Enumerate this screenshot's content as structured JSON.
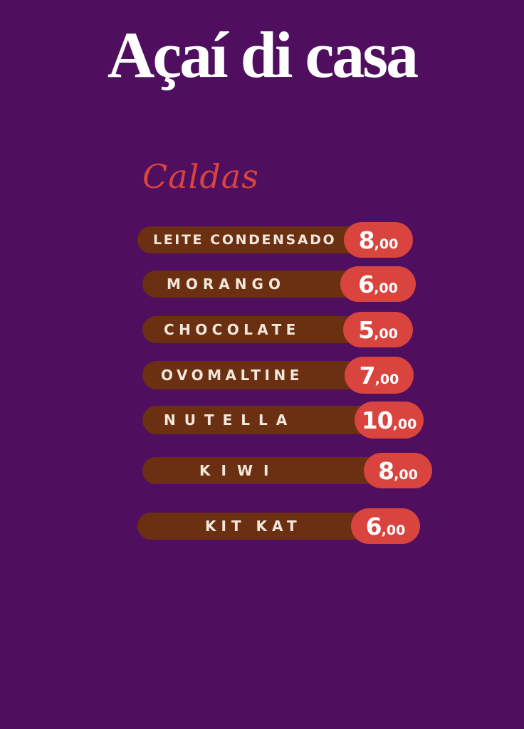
{
  "colors": {
    "background": "#4f0f5e",
    "title": "#ffffff",
    "section_heading": "#d9443f",
    "item_bar": "#6b2f12",
    "price_pill": "#d9443f",
    "item_text": "#f4e8dc"
  },
  "menu": {
    "title": "Açaí di casa",
    "section_title": "Caldas",
    "items": [
      {
        "name": "LEITE CONDENSADO",
        "price_int": "8",
        "price_dec": ",00"
      },
      {
        "name": "MORANGO",
        "price_int": "6",
        "price_dec": ",00"
      },
      {
        "name": "CHOCOLATE",
        "price_int": "5",
        "price_dec": ",00"
      },
      {
        "name": "OVOMALTINE",
        "price_int": "7",
        "price_dec": ",00"
      },
      {
        "name": "NUTELLA",
        "price_int": "10",
        "price_dec": ",00"
      },
      {
        "name": "KIWI",
        "price_int": "8",
        "price_dec": ",00"
      },
      {
        "name": "KIT KAT",
        "price_int": "6",
        "price_dec": ",00"
      }
    ]
  }
}
